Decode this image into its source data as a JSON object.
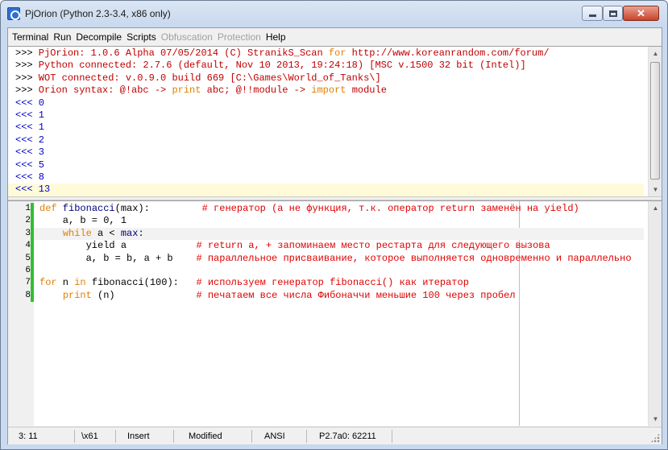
{
  "window": {
    "title": "PjOrion (Python 2.3-3.4, x86 only)",
    "close_glyph": "✕"
  },
  "menu": [
    {
      "label": "Terminal",
      "enabled": true
    },
    {
      "label": "Run",
      "enabled": true
    },
    {
      "label": "Decompile",
      "enabled": true
    },
    {
      "label": "Scripts",
      "enabled": true
    },
    {
      "label": "Obfuscation",
      "enabled": false
    },
    {
      "label": "Protection",
      "enabled": false
    },
    {
      "label": "Help",
      "enabled": true
    }
  ],
  "terminal": {
    "lines": [
      {
        "prompt": ">>>",
        "segments": [
          {
            "t": " PjOrion: 1.0.6 Alpha 07/05/2014 (C) StranikS_Scan ",
            "c": ""
          },
          {
            "t": "for",
            "c": "kw"
          },
          {
            "t": " http://www.koreanrandom.com/forum/",
            "c": ""
          }
        ]
      },
      {
        "prompt": ">>>",
        "segments": [
          {
            "t": " Python connected: 2.7.6 (default, Nov 10 2013, 19:24:18) [MSC v.1500 32 bit (Intel)]",
            "c": ""
          }
        ]
      },
      {
        "prompt": ">>>",
        "segments": [
          {
            "t": " WOT connected: v.0.9.0 build 669 [C:\\Games\\World_of_Tanks\\]",
            "c": ""
          }
        ]
      },
      {
        "prompt": ">>>",
        "segments": [
          {
            "t": " Orion syntax: @!abc -> ",
            "c": ""
          },
          {
            "t": "print",
            "c": "kw"
          },
          {
            "t": " abc; @!!module -> ",
            "c": ""
          },
          {
            "t": "import",
            "c": "kw"
          },
          {
            "t": " module",
            "c": ""
          }
        ]
      },
      {
        "prompt": "<<<",
        "segments": [
          {
            "t": " 0",
            "c": "out"
          }
        ]
      },
      {
        "prompt": "<<<",
        "segments": [
          {
            "t": " 1",
            "c": "out"
          }
        ]
      },
      {
        "prompt": "<<<",
        "segments": [
          {
            "t": " 1",
            "c": "out"
          }
        ]
      },
      {
        "prompt": "<<<",
        "segments": [
          {
            "t": " 2",
            "c": "out"
          }
        ]
      },
      {
        "prompt": "<<<",
        "segments": [
          {
            "t": " 3",
            "c": "out"
          }
        ]
      },
      {
        "prompt": "<<<",
        "segments": [
          {
            "t": " 5",
            "c": "out"
          }
        ]
      },
      {
        "prompt": "<<<",
        "segments": [
          {
            "t": " 8",
            "c": "out"
          }
        ]
      },
      {
        "prompt": "<<<",
        "segments": [
          {
            "t": " 13",
            "c": "out"
          }
        ],
        "current": true
      }
    ]
  },
  "editor": {
    "lines": [
      {
        "n": "1",
        "changed": true,
        "segments": [
          {
            "t": "def",
            "c": "kw"
          },
          {
            "t": " fibonacci",
            "c": "fn"
          },
          {
            "t": "(max):         ",
            "c": ""
          },
          {
            "t": "# генератор (а не функция, т.к. оператор return заменён на yield)",
            "c": "cm"
          }
        ]
      },
      {
        "n": "2",
        "changed": true,
        "segments": [
          {
            "t": "    a, b = 0, 1",
            "c": ""
          }
        ]
      },
      {
        "n": "3",
        "changed": true,
        "current": true,
        "segments": [
          {
            "t": "    ",
            "c": ""
          },
          {
            "t": "while",
            "c": "kw"
          },
          {
            "t": " a < ",
            "c": ""
          },
          {
            "t": "max",
            "c": "fn"
          },
          {
            "t": ":",
            "c": ""
          }
        ]
      },
      {
        "n": "4",
        "changed": true,
        "segments": [
          {
            "t": "        yield a            ",
            "c": ""
          },
          {
            "t": "# return a, + запоминаем место рестарта для следующего вызова",
            "c": "cm"
          }
        ]
      },
      {
        "n": "5",
        "changed": true,
        "segments": [
          {
            "t": "        a, b = b, a + b    ",
            "c": ""
          },
          {
            "t": "# параллельное присваивание, которое выполняется одновременно и параллельно",
            "c": "cm"
          }
        ]
      },
      {
        "n": "6",
        "changed": true,
        "segments": []
      },
      {
        "n": "7",
        "changed": true,
        "segments": [
          {
            "t": "for",
            "c": "kw"
          },
          {
            "t": " n ",
            "c": ""
          },
          {
            "t": "in",
            "c": "kw"
          },
          {
            "t": " fibonacci(100):   ",
            "c": ""
          },
          {
            "t": "# используем генератор fibonacci() как итератор",
            "c": "cm"
          }
        ]
      },
      {
        "n": "8",
        "changed": true,
        "segments": [
          {
            "t": "    ",
            "c": ""
          },
          {
            "t": "print",
            "c": "kw"
          },
          {
            "t": " (n)              ",
            "c": ""
          },
          {
            "t": "# печатаем все числа Фибоначчи меньшие 100 через пробел",
            "c": "cm"
          }
        ]
      }
    ]
  },
  "status": {
    "position": "3: 11",
    "char": "\\x61",
    "mode": "Insert",
    "modified": "Modified",
    "encoding": "ANSI",
    "info": "P2.7a0: 62211"
  }
}
